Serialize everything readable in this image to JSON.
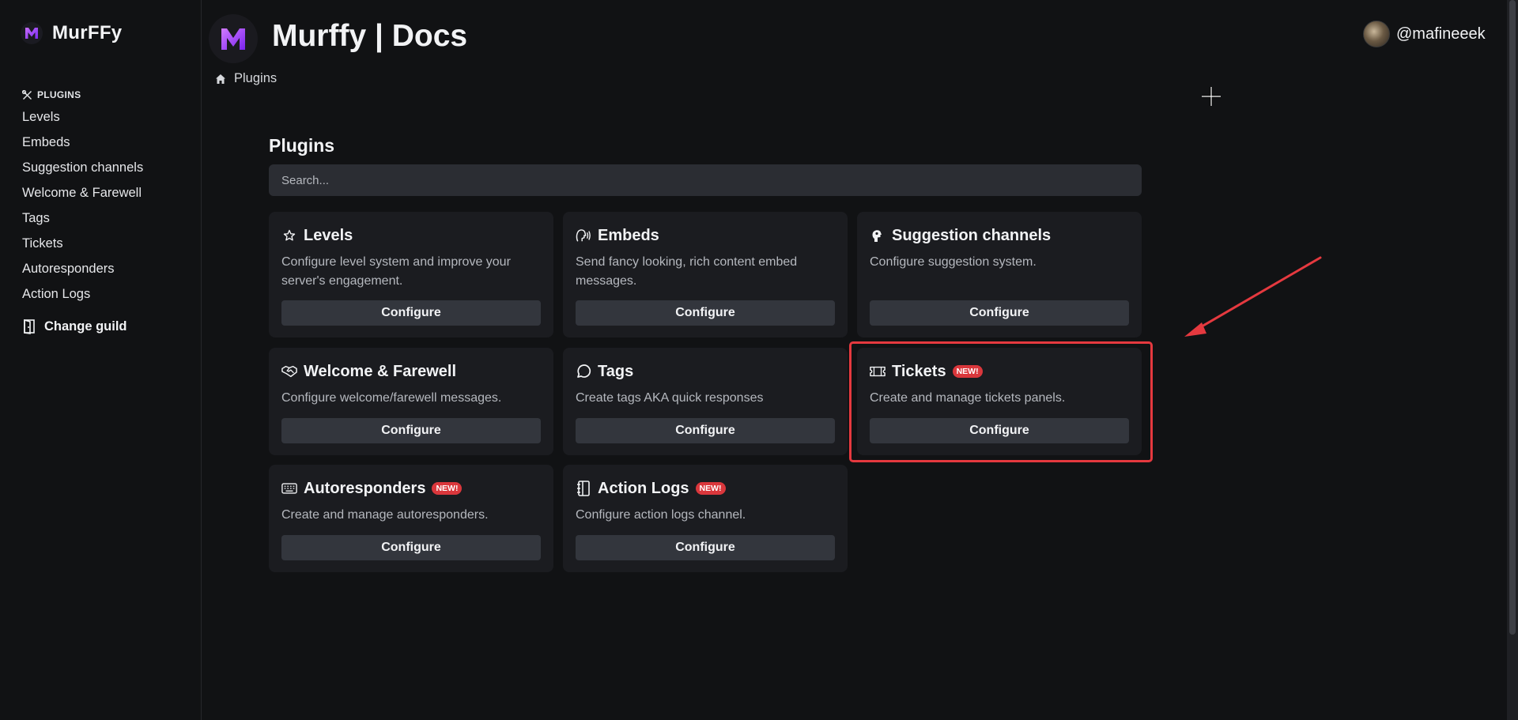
{
  "brand": {
    "name": "MurFFy"
  },
  "header": {
    "title": "Murffy | Docs",
    "breadcrumb": "Plugins"
  },
  "user": {
    "name": "@mafineeek"
  },
  "sidebar": {
    "section_label": "PLUGINS",
    "items": [
      {
        "label": "Levels"
      },
      {
        "label": "Embeds"
      },
      {
        "label": "Suggestion channels"
      },
      {
        "label": "Welcome & Farewell"
      },
      {
        "label": "Tags"
      },
      {
        "label": "Tickets"
      },
      {
        "label": "Autoresponders"
      },
      {
        "label": "Action Logs"
      }
    ],
    "change_guild": "Change guild"
  },
  "main": {
    "title": "Plugins",
    "search_placeholder": "Search...",
    "configure_label": "Configure",
    "new_badge": "NEW!",
    "cards": [
      {
        "title": "Levels",
        "icon": "star-icon",
        "desc": "Configure level system and improve your server's engagement."
      },
      {
        "title": "Embeds",
        "icon": "speaker-head-icon",
        "desc": "Send fancy looking, rich content embed messages."
      },
      {
        "title": "Suggestion channels",
        "icon": "head-icon",
        "desc": "Configure suggestion system."
      },
      {
        "title": "Welcome & Farewell",
        "icon": "handshake-icon",
        "desc": "Configure welcome/farewell messages."
      },
      {
        "title": "Tags",
        "icon": "message-circle-icon",
        "desc": "Create tags AKA quick responses"
      },
      {
        "title": "Tickets",
        "icon": "ticket-icon",
        "desc": "Create and manage tickets panels.",
        "new": true
      },
      {
        "title": "Autoresponders",
        "icon": "keyboard-icon",
        "desc": "Create and manage autoresponders.",
        "new": true
      },
      {
        "title": "Action Logs",
        "icon": "notebook-icon",
        "desc": "Configure action logs channel.",
        "new": true
      }
    ]
  },
  "colors": {
    "accent": "#9b3cf5",
    "highlight": "#e5393f",
    "badge": "#da373c"
  }
}
